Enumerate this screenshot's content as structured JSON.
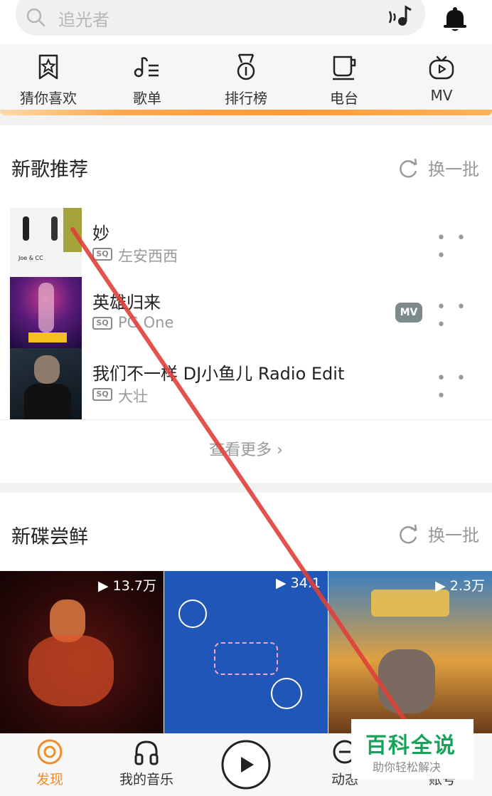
{
  "search": {
    "placeholder": "追光者"
  },
  "categories": [
    {
      "label": "猜你喜欢",
      "icon": "star-bookmark-icon"
    },
    {
      "label": "歌单",
      "icon": "music-note-list-icon"
    },
    {
      "label": "排行榜",
      "icon": "medal-icon"
    },
    {
      "label": "电台",
      "icon": "cup-icon"
    },
    {
      "label": "MV",
      "icon": "tv-play-icon"
    }
  ],
  "new_songs": {
    "title": "新歌推荐",
    "refresh_label": "换一批",
    "see_more": "查看更多 ›",
    "items": [
      {
        "title": "妙",
        "quality": "SQ",
        "artist": "左安西西",
        "cover_text": "Joe & CC",
        "has_mv": false
      },
      {
        "title": "英雄归来",
        "quality": "SQ",
        "artist": "PG One",
        "cover_text": "",
        "has_mv": true,
        "mv_label": "MV"
      },
      {
        "title": "我们不一样 DJ小鱼儿 Radio Edit",
        "quality": "SQ",
        "artist": "大壮",
        "cover_text": "",
        "has_mv": false
      }
    ]
  },
  "new_albums": {
    "title": "新碟尝鲜",
    "refresh_label": "换一批",
    "items": [
      {
        "plays": "▶ 13.7万"
      },
      {
        "plays": "▶ 34.1"
      },
      {
        "plays": "▶ 2.3万"
      }
    ]
  },
  "bottom_nav": {
    "items": [
      {
        "label": "发现",
        "active": true
      },
      {
        "label": "我的音乐",
        "active": false
      },
      {
        "label": "",
        "play_button": true
      },
      {
        "label": "动态",
        "active": false
      },
      {
        "label": "账号",
        "active": false
      }
    ]
  },
  "watermark": {
    "title": "百科全说",
    "subtitle": "助你轻松解决"
  },
  "colors": {
    "accent": "#ff9a33",
    "active_nav": "#f28c28",
    "annotation_line": "#e0403a",
    "watermark_green": "#19a35a"
  }
}
